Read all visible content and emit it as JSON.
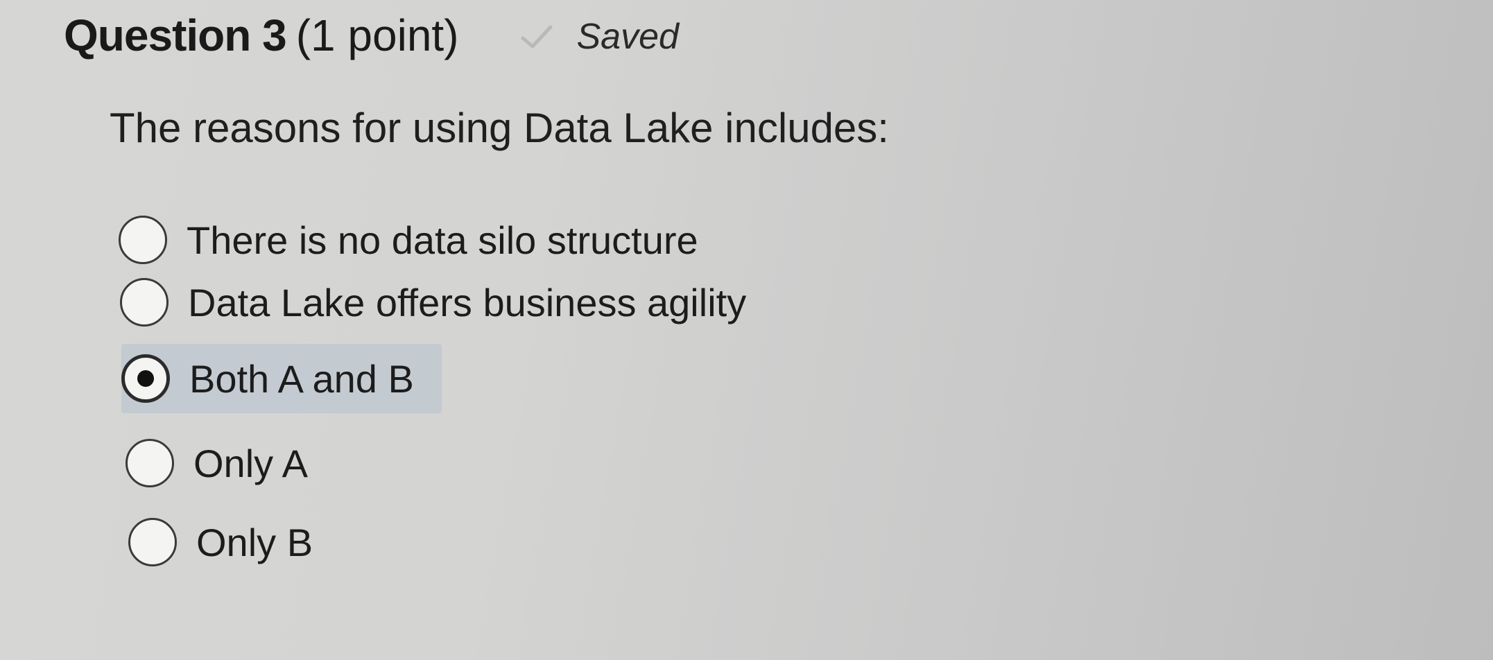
{
  "question": {
    "title": "Question 3",
    "points": "(1 point)",
    "status": {
      "icon": "check-icon",
      "label": "Saved"
    },
    "prompt": "The reasons for using Data Lake includes:"
  },
  "options": [
    {
      "label": "There is no data silo structure",
      "selected": false
    },
    {
      "label": "Data Lake offers business agility",
      "selected": false
    },
    {
      "label": "Both A and B",
      "selected": true
    },
    {
      "label": "Only A",
      "selected": false
    },
    {
      "label": "Only B",
      "selected": false
    }
  ],
  "colors": {
    "selected_highlight": "#b4c3d6",
    "text": "#1d1d1d"
  }
}
